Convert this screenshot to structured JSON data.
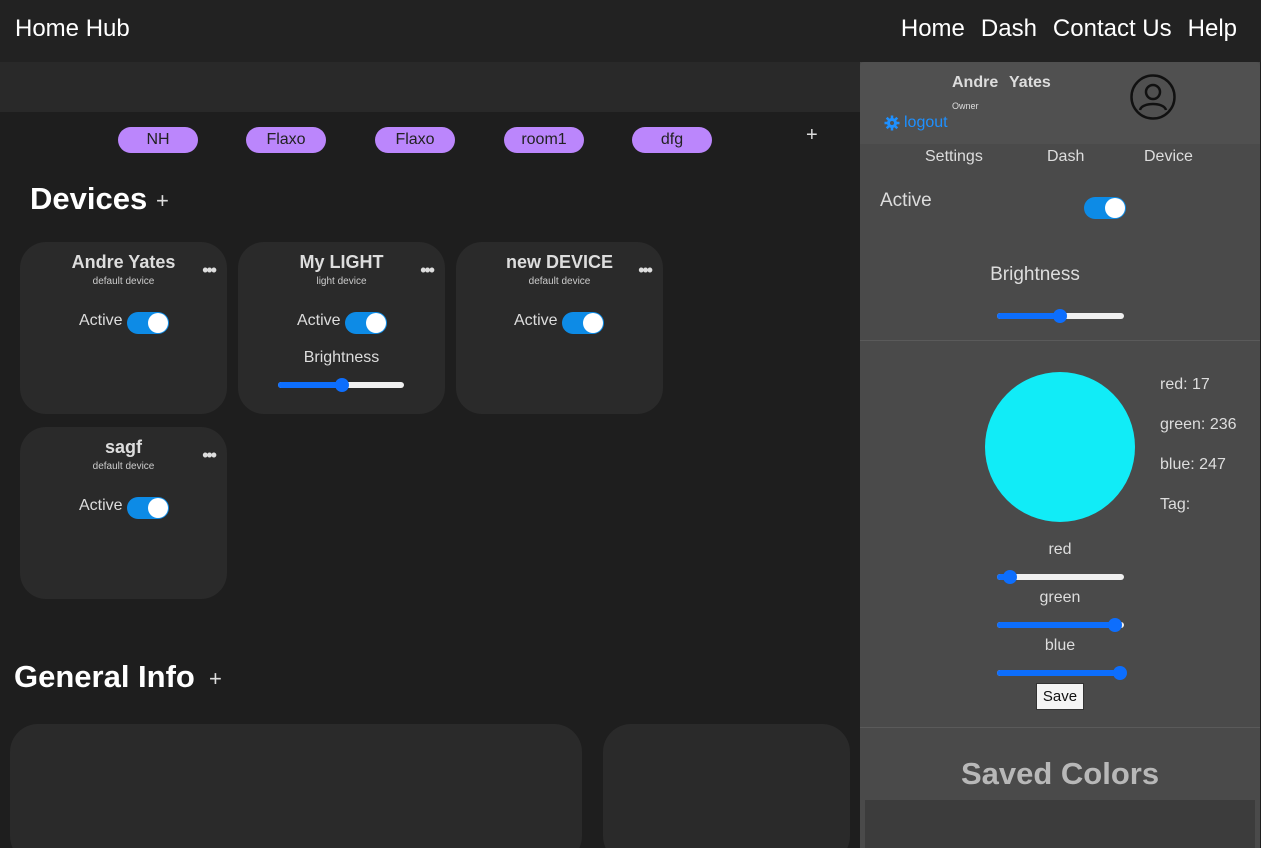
{
  "nav": {
    "brand": "Home Hub",
    "links": [
      "Home",
      "Dash",
      "Contact Us",
      "Help"
    ]
  },
  "rooms": {
    "tabs": [
      "NH",
      "Flaxo",
      "Flaxo",
      "room1",
      "dfg"
    ],
    "add_label": "+"
  },
  "devices": {
    "title": "Devices",
    "add_label": "+",
    "items": [
      {
        "name": "Andre Yates",
        "type": "default device",
        "active_label": "Active",
        "active": true
      },
      {
        "name": "My LIGHT",
        "type": "light device",
        "active_label": "Active",
        "active": true,
        "brightness_label": "Brightness",
        "brightness": 0.5
      },
      {
        "name": "new DEVICE",
        "type": "default device",
        "active_label": "Active",
        "active": true
      },
      {
        "name": "sagf",
        "type": "default device",
        "active_label": "Active",
        "active": true
      }
    ],
    "menu_label": "•••"
  },
  "general": {
    "title": "General Info",
    "add_label": "+"
  },
  "panel": {
    "first_name": "Andre",
    "last_name": "Yates",
    "role": "Owner",
    "logout_label": "logout",
    "tabs": [
      "Settings",
      "Dash",
      "Device"
    ],
    "active_label": "Active",
    "active": true,
    "brightness_label": "Brightness",
    "brightness": 0.5,
    "color": {
      "hex": "#11ecf7",
      "red": 17,
      "green": 236,
      "blue": 247
    },
    "red_text": "red: 17",
    "green_text": "green: 236",
    "blue_text": "blue: 247",
    "tag_text": "Tag:",
    "red_label": "red",
    "green_label": "green",
    "blue_label": "blue",
    "save_label": "Save",
    "saved_title": "Saved Colors"
  },
  "colors": {
    "accent": "#0d6efd",
    "toggle": "#0d8be6",
    "pill": "#bb86fc",
    "link": "#1e90ff"
  }
}
